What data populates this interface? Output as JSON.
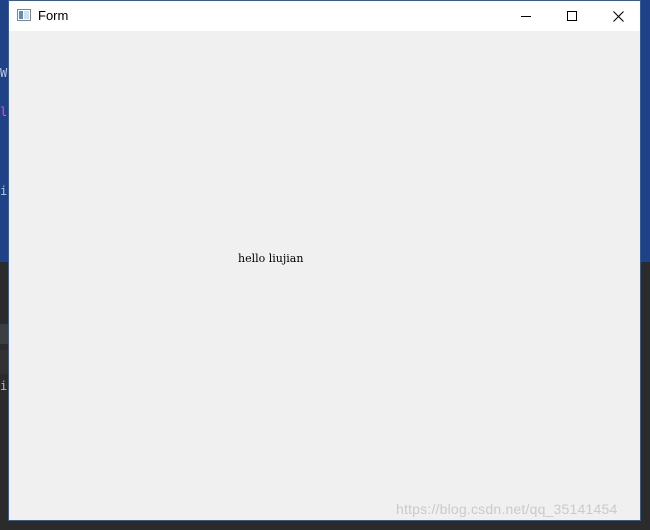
{
  "window": {
    "title": "Form",
    "icon": "app-window-icon",
    "controls": {
      "minimize_icon": "minimize-icon",
      "maximize_icon": "maximize-icon",
      "close_icon": "close-icon"
    }
  },
  "content": {
    "label_text": "hello liujian"
  },
  "background": {
    "peek_chars": [
      "W",
      "l",
      "i",
      "i"
    ]
  },
  "watermark": {
    "text": "https://blog.csdn.net/qq_35141454"
  },
  "colors": {
    "window_border": "#2c5caa",
    "client_bg": "#f0f0f0",
    "titlebar_bg": "#ffffff",
    "ide_blue": "#1f4287",
    "ide_dark": "#2b2b2b"
  }
}
